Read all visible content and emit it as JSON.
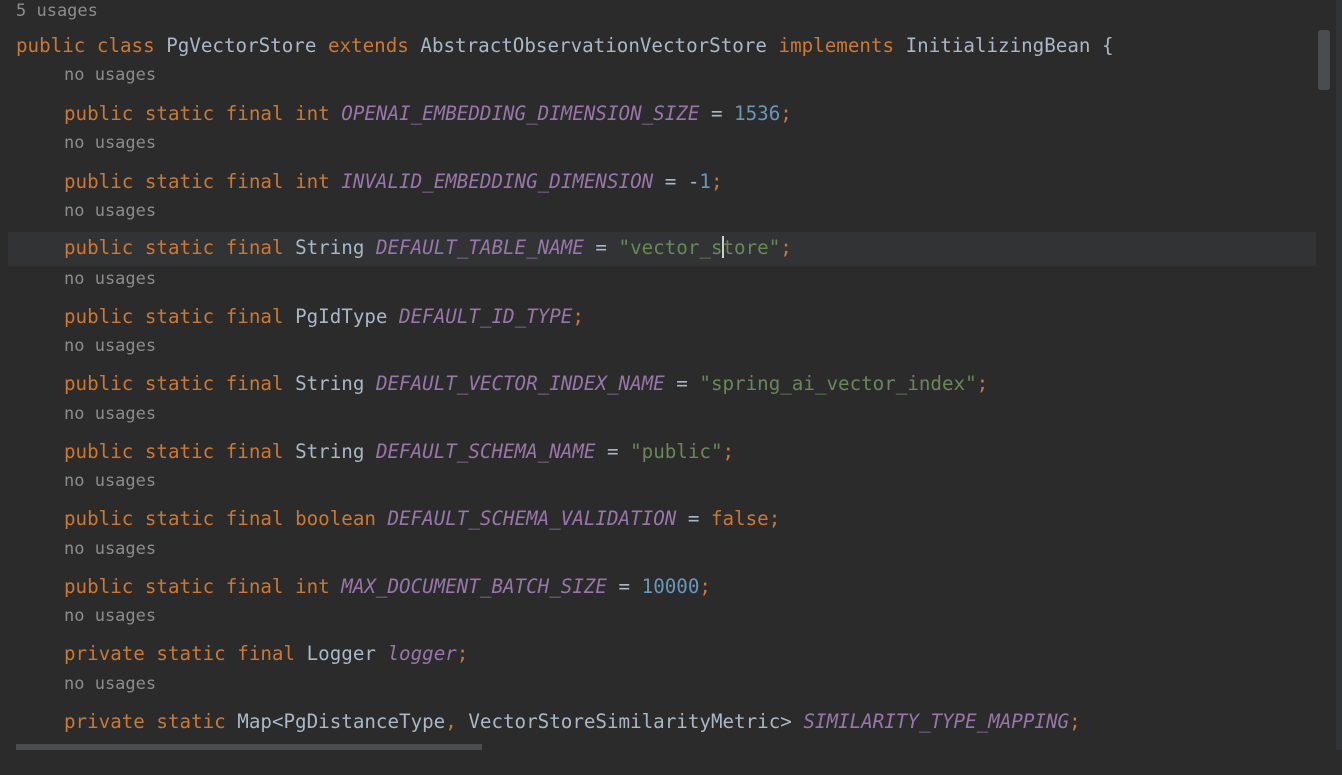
{
  "editor": {
    "class_usages": "5 usages",
    "field_usage_hint": "no usages",
    "class_line": {
      "kw_public": "public",
      "kw_class": "class",
      "class_name": "PgVectorStore",
      "kw_extends": "extends",
      "super_class": "AbstractObservationVectorStore",
      "kw_implements": "implements",
      "interface_name": "InitializingBean",
      "brace": "{"
    },
    "fields": [
      {
        "usage": "no usages",
        "mods": "public static final",
        "type": "int",
        "name": "OPENAI_EMBEDDING_DIMENSION_SIZE",
        "assign": " = ",
        "value": "1536",
        "semi": ";"
      },
      {
        "usage": "no usages",
        "mods": "public static final",
        "type": "int",
        "name": "INVALID_EMBEDDING_DIMENSION",
        "assign": " = -",
        "value": "1",
        "semi": ";"
      },
      {
        "usage": "no usages",
        "mods": "public static final",
        "type": "String",
        "name": "DEFAULT_TABLE_NAME",
        "assign": " = ",
        "value_a": "\"vector_s",
        "value_b": "tore\"",
        "semi": ";"
      },
      {
        "usage": "no usages",
        "mods": "public static final",
        "type": "PgIdType",
        "name": "DEFAULT_ID_TYPE",
        "semi": ";"
      },
      {
        "usage": "no usages",
        "mods": "public static final",
        "type": "String",
        "name": "DEFAULT_VECTOR_INDEX_NAME",
        "assign": " = ",
        "value": "\"spring_ai_vector_index\"",
        "semi": ";"
      },
      {
        "usage": "no usages",
        "mods": "public static final",
        "type": "String",
        "name": "DEFAULT_SCHEMA_NAME",
        "assign": " = ",
        "value": "\"public\"",
        "semi": ";"
      },
      {
        "usage": "no usages",
        "mods": "public static final",
        "type": "boolean",
        "name": "DEFAULT_SCHEMA_VALIDATION",
        "assign": " = ",
        "value": "false",
        "semi": ";"
      },
      {
        "usage": "no usages",
        "mods": "public static final",
        "type": "int",
        "name": "MAX_DOCUMENT_BATCH_SIZE",
        "assign": " = ",
        "value": "10000",
        "semi": ";"
      },
      {
        "usage": "no usages",
        "mods": "private static final",
        "type": "Logger",
        "name": "logger",
        "semi": ";"
      },
      {
        "usage": "no usages",
        "mods": "private static",
        "type_a": "Map<PgDistanceType",
        "type_comma": ",",
        "type_b": " VectorStoreSimilarityMetric>",
        "name": "SIMILARITY_TYPE_MAPPING",
        "semi": ";"
      }
    ]
  },
  "colors": {
    "background": "#2b2b2b",
    "keyword": "#cc7832",
    "identifier": "#a9b7c6",
    "constant": "#9876aa",
    "number": "#6897bb",
    "string": "#6a8759",
    "usage_hint": "#8c8c8c",
    "current_line": "#313335"
  }
}
